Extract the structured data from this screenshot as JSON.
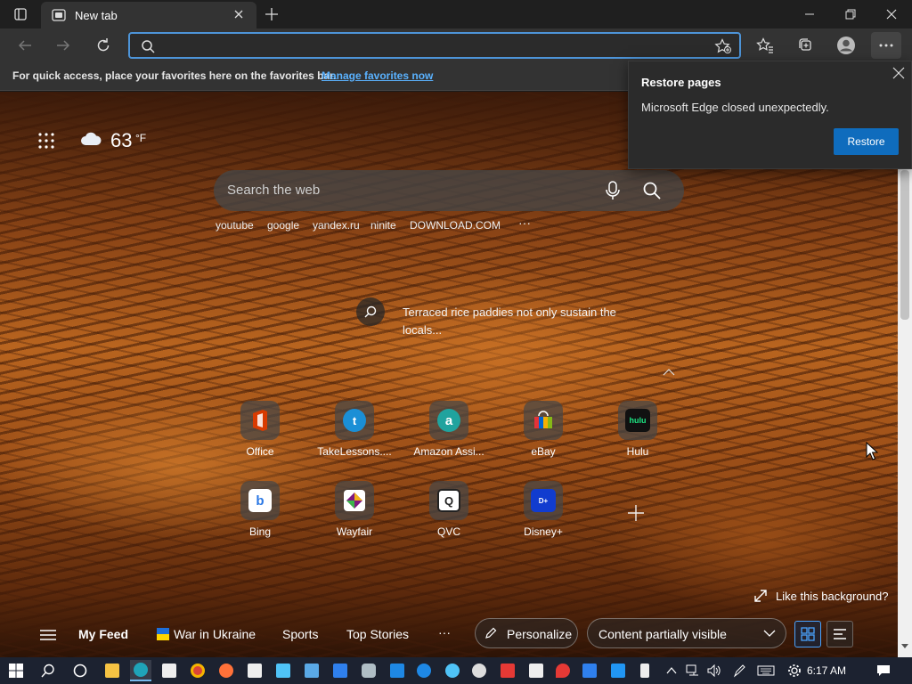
{
  "browser": {
    "tab_title": "New tab",
    "address_value": "",
    "favorites_bar_text": "For quick access, place your favorites here on the favorites bar.",
    "favorites_bar_link": "Manage favorites now"
  },
  "restore_popup": {
    "title": "Restore pages",
    "message": "Microsoft Edge closed unexpectedly.",
    "button": "Restore"
  },
  "weather": {
    "temp": "63",
    "unit": "°F",
    "icon": "cloud-icon"
  },
  "search": {
    "placeholder": "Search the web",
    "quick_links": [
      "youtube",
      "google",
      "yandex.ru",
      "ninite",
      "DOWNLOAD.COM"
    ],
    "more": "···"
  },
  "caption": "Terraced rice paddies not only sustain the locals...",
  "tiles": [
    {
      "label": "Office",
      "icon": "office-icon",
      "color": "#d83b01"
    },
    {
      "label": "TakeLessons....",
      "icon": "takelessons-icon",
      "color": "#1b8fd6"
    },
    {
      "label": "Amazon Assi...",
      "icon": "amazon-assistant-icon",
      "color": "#20a39e"
    },
    {
      "label": "eBay",
      "icon": "ebay-icon",
      "color": "#e53238"
    },
    {
      "label": "Hulu",
      "icon": "hulu-icon",
      "color": "#1ce783"
    },
    {
      "label": "Bing",
      "icon": "bing-icon",
      "color": "#2b78e4"
    },
    {
      "label": "Wayfair",
      "icon": "wayfair-icon",
      "color": "#7f187f"
    },
    {
      "label": "QVC",
      "icon": "qvc-icon",
      "color": "#ffffff"
    },
    {
      "label": "Disney+",
      "icon": "disney-plus-icon",
      "color": "#113ccf"
    }
  ],
  "like_background": "Like this background?",
  "feed": {
    "my_feed": "My Feed",
    "war": "War in Ukraine",
    "sports": "Sports",
    "top_stories": "Top Stories",
    "more": "···",
    "personalize": "Personalize",
    "content_visible": "Content partially visible"
  },
  "taskbar": {
    "time": "6:17 AM"
  }
}
